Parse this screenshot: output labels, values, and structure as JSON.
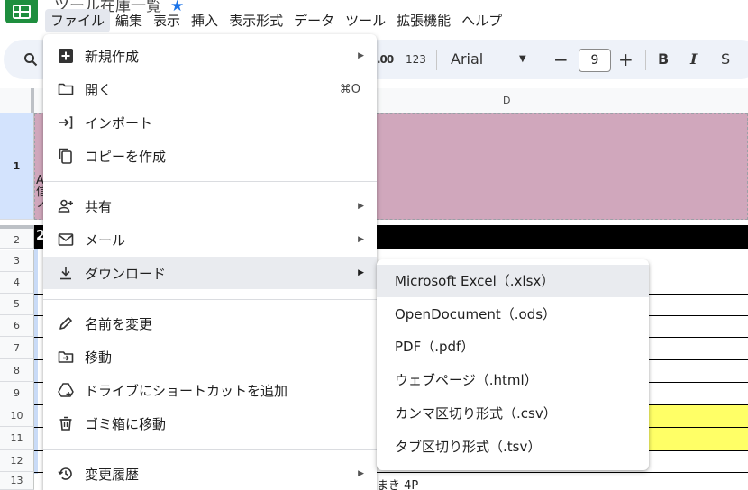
{
  "app": {
    "title": "ツール在庫一覧",
    "accent": "#1e8e3e",
    "star_icon": "star-icon"
  },
  "menubar": [
    {
      "label": "ファイル"
    },
    {
      "label": "編集"
    },
    {
      "label": "表示"
    },
    {
      "label": "挿入"
    },
    {
      "label": "表示形式"
    },
    {
      "label": "データ"
    },
    {
      "label": "ツール"
    },
    {
      "label": "拡張機能"
    },
    {
      "label": "ヘルプ"
    }
  ],
  "toolbar": {
    "decimal_label": ".00",
    "number_format_label": "123",
    "font": "Arial",
    "font_size": "9",
    "minus": "−",
    "plus": "+",
    "bold": "B",
    "italic": "I",
    "strike": "S"
  },
  "grid": {
    "column_d": "D",
    "rows": [
      "1",
      "2",
      "3",
      "4",
      "5",
      "6",
      "7",
      "8",
      "9",
      "10",
      "11",
      "12",
      "13"
    ],
    "pink_fragment": "A\n信\nノ",
    "black_fragment": "2",
    "bottom_text": "まき 4P",
    "colors": {
      "pink": "#d0a7bc",
      "black": "#000000",
      "yellow": "#ffff66"
    }
  },
  "file_menu": {
    "items": [
      {
        "label": "新規作成",
        "icon": "add-box-icon",
        "has_submenu": true
      },
      {
        "label": "開く",
        "icon": "folder-icon",
        "shortcut": "⌘O"
      },
      {
        "label": "インポート",
        "icon": "import-icon"
      },
      {
        "label": "コピーを作成",
        "icon": "copy-icon"
      },
      {
        "label": "共有",
        "icon": "person-add-icon",
        "has_submenu": true
      },
      {
        "label": "メール",
        "icon": "mail-icon",
        "has_submenu": true
      },
      {
        "label": "ダウンロード",
        "icon": "download-icon",
        "has_submenu": true,
        "highlighted": true
      },
      {
        "label": "名前を変更",
        "icon": "pencil-icon"
      },
      {
        "label": "移動",
        "icon": "move-folder-icon"
      },
      {
        "label": "ドライブにショートカットを追加",
        "icon": "drive-shortcut-icon"
      },
      {
        "label": "ゴミ箱に移動",
        "icon": "trash-icon"
      },
      {
        "label": "変更履歴",
        "icon": "history-icon",
        "has_submenu": true
      }
    ]
  },
  "download_submenu": {
    "items": [
      {
        "label": "Microsoft Excel（.xlsx）",
        "highlighted": true
      },
      {
        "label": "OpenDocument（.ods）"
      },
      {
        "label": "PDF（.pdf）"
      },
      {
        "label": "ウェブページ（.html）"
      },
      {
        "label": "カンマ区切り形式（.csv）"
      },
      {
        "label": "タブ区切り形式（.tsv）"
      }
    ]
  }
}
